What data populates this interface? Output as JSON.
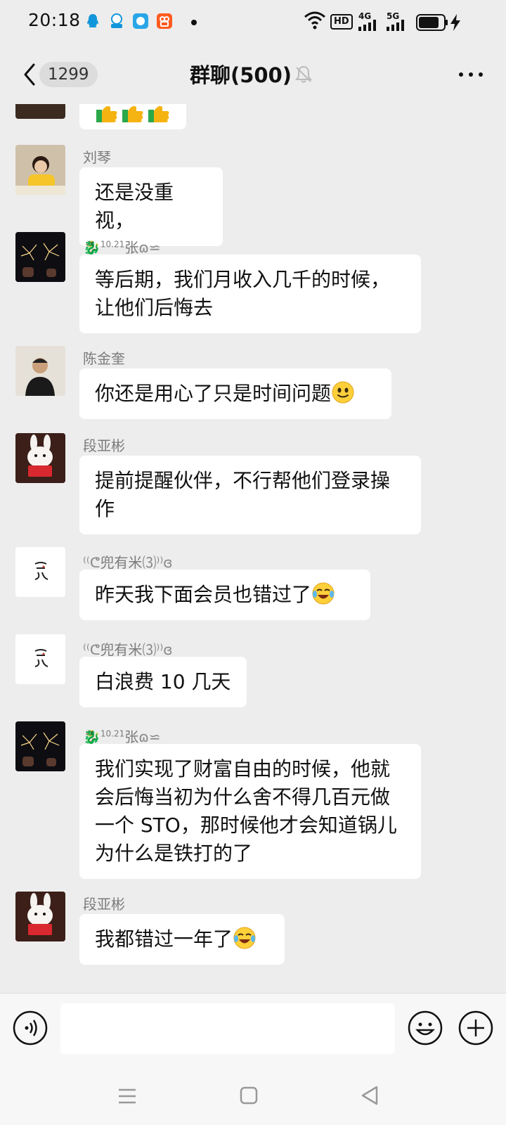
{
  "status_bar": {
    "time": "20:18",
    "network": "HD",
    "network_4g": "4G",
    "network_5g": "5G",
    "icons": [
      "qq-icon",
      "qq-contact-icon",
      "mail-app-icon",
      "kuaishou-icon",
      "wifi-icon",
      "signal-icon",
      "battery-icon",
      "charging-icon"
    ]
  },
  "header": {
    "unread_count": "1299",
    "title": "群聊(500)"
  },
  "messages": [
    {
      "sender": "",
      "text": "",
      "avatar": "partial-avatar",
      "bubble_emoji": "thumbs-up x3"
    },
    {
      "sender": "刘琴",
      "text": "还是没重视，"
    },
    {
      "sender": "张",
      "sender_prefix": "10.21",
      "text": "等后期，我们月收入几千的时候，让他们后悔去"
    },
    {
      "sender": "陈金奎",
      "text": "你还是用心了只是时间问题",
      "emoji": "smile-emoji"
    },
    {
      "sender": "段亚彬",
      "text": "提前提醒伙伴，不行帮他们登录操作"
    },
    {
      "sender": "兜有米",
      "text": "昨天我下面会员也错过了",
      "emoji": "laugh-cry-emoji"
    },
    {
      "sender": "兜有米",
      "text": "白浪费 10 几天"
    },
    {
      "sender": "张",
      "sender_prefix": "10.21",
      "text": "我们实现了财富自由的时候，他就会后悔当初为什么舍不得几百元做一个 STO，那时候他才会知道锅儿为什么是铁打的了"
    },
    {
      "sender": "段亚彬",
      "text": "我都错过一年了",
      "emoji": "laugh-cry-emoji"
    }
  ],
  "input": {
    "value": "",
    "placeholder": ""
  },
  "colors": {
    "background": "#ededed",
    "bubble": "#ffffff",
    "sender_name": "#7b7b7b"
  }
}
